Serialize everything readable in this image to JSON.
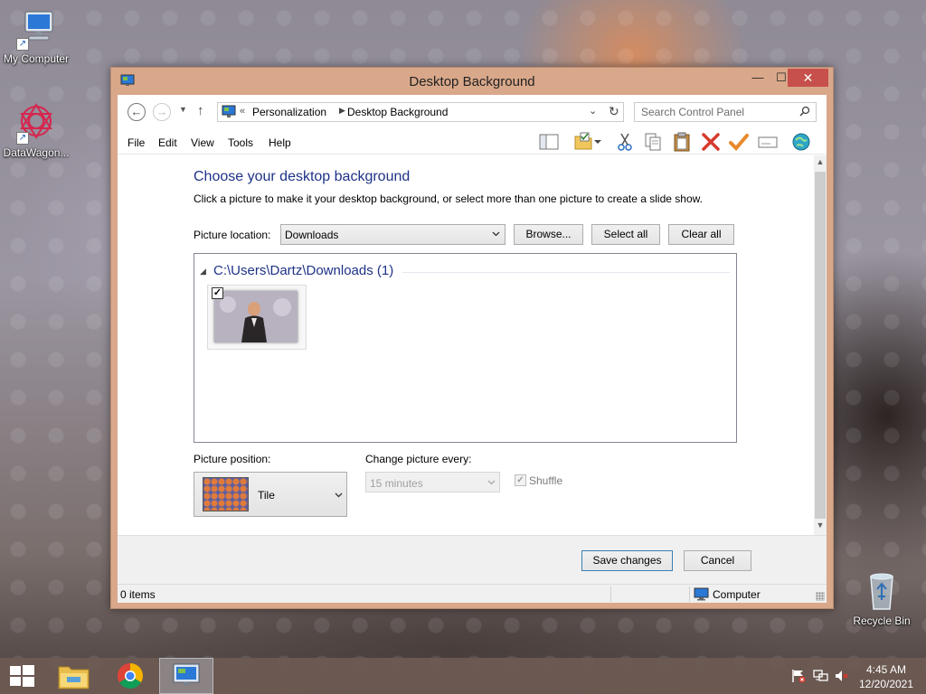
{
  "desktop": {
    "icons": [
      {
        "label": "My Computer"
      },
      {
        "label": "DataWagon..."
      },
      {
        "label": "Recycle Bin"
      }
    ]
  },
  "window": {
    "title": "Desktop Background",
    "address": {
      "prefix": "«",
      "crumbs": [
        "Personalization",
        "Desktop Background"
      ],
      "search_placeholder": "Search Control Panel"
    },
    "menu": [
      "File",
      "Edit",
      "View",
      "Tools",
      "Help"
    ],
    "content": {
      "heading": "Choose your desktop background",
      "subtext": "Click a picture to make it your desktop background, or select more than one picture to create a slide show.",
      "picture_location_label": "Picture location:",
      "picture_location_value": "Downloads",
      "browse_label": "Browse...",
      "select_all_label": "Select all",
      "clear_all_label": "Clear all",
      "group_title": "C:\\Users\\Dartz\\Downloads (1)",
      "thumbnail_checked": true,
      "picture_position_label": "Picture position:",
      "picture_position_value": "Tile",
      "change_every_label": "Change picture every:",
      "change_every_value": "15 minutes",
      "shuffle_label": "Shuffle",
      "shuffle_checked": true
    },
    "footer": {
      "save_label": "Save changes",
      "cancel_label": "Cancel"
    },
    "status": {
      "items": "0 items",
      "location": "Computer"
    }
  },
  "taskbar": {
    "time": "4:45 AM",
    "date": "12/20/2021"
  },
  "colors": {
    "window_frame": "#d9a88a",
    "close_button": "#c7504c",
    "heading_blue": "#1e3287",
    "taskbar": "#6c5a52"
  }
}
